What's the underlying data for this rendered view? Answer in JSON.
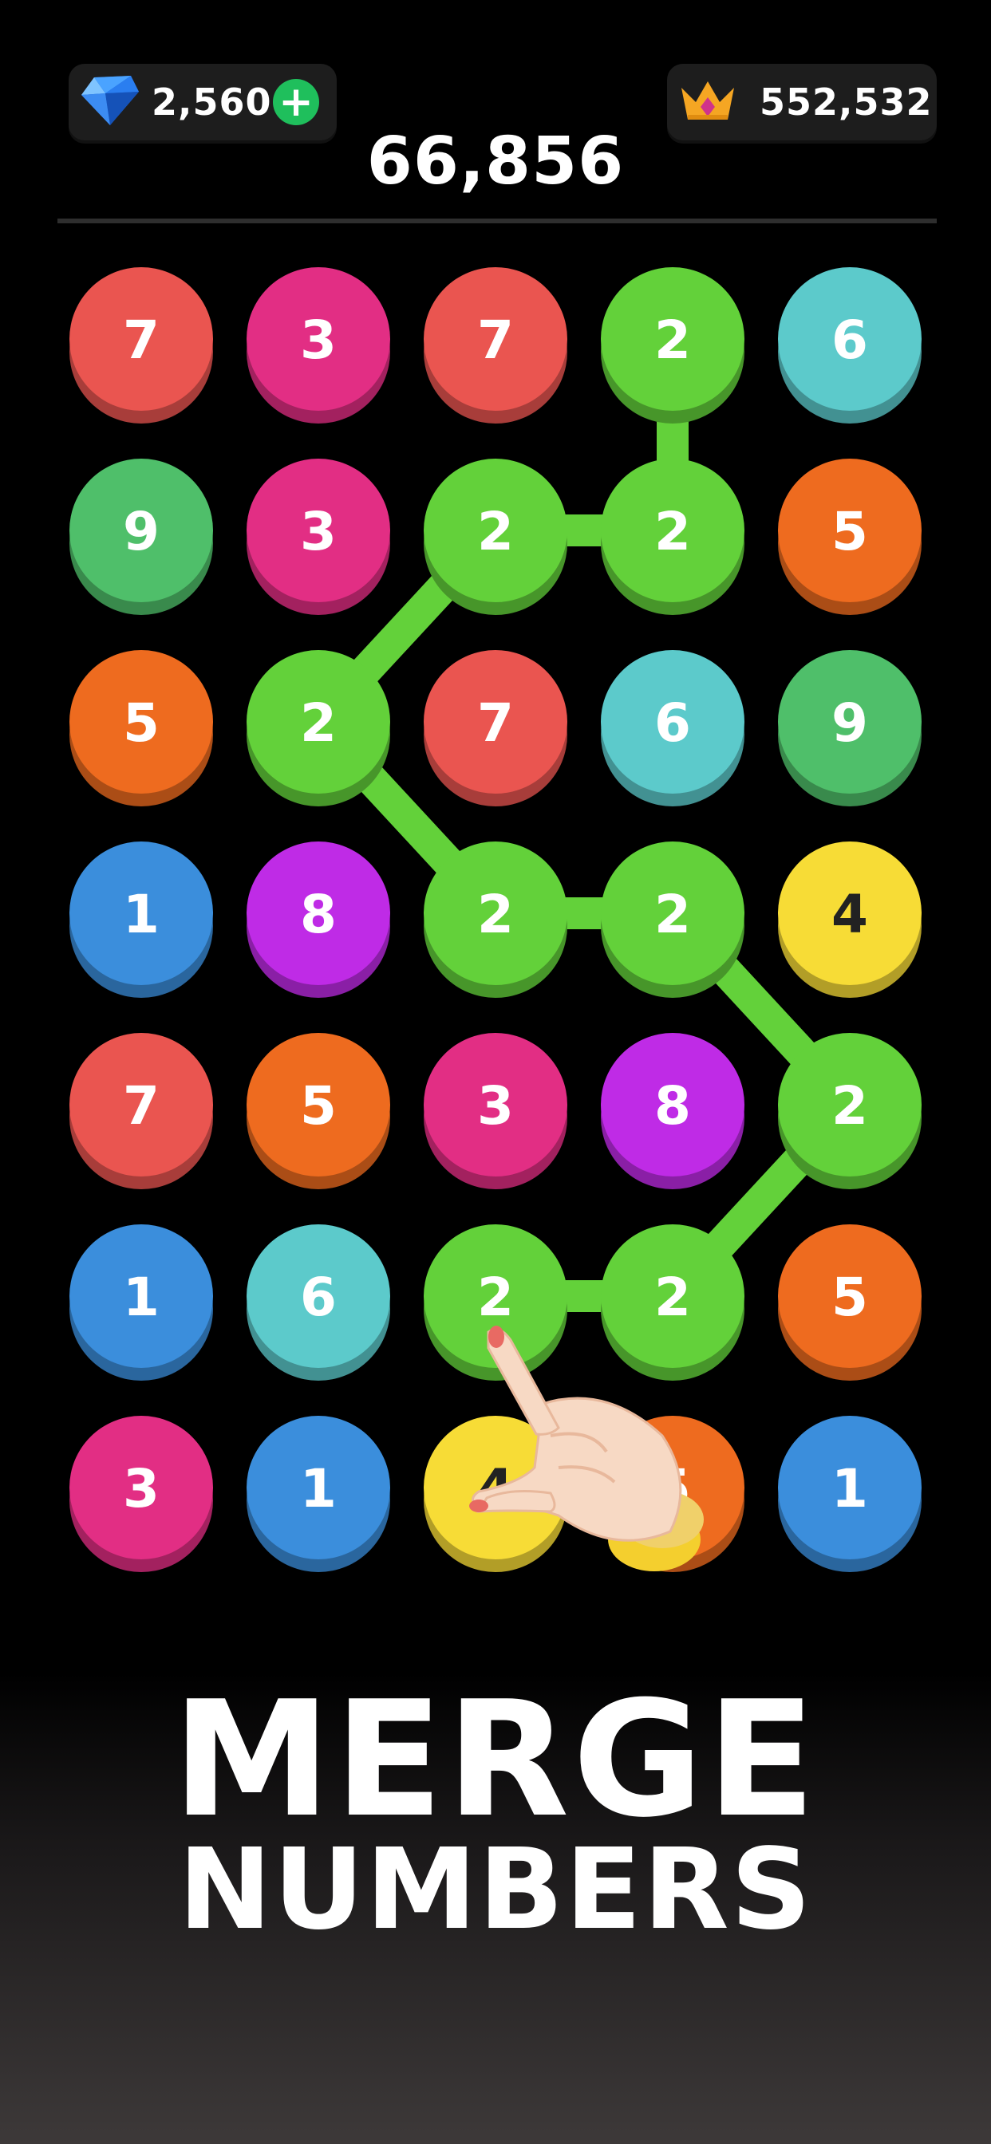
{
  "hud": {
    "gems": "2,560",
    "best_score": "552,532",
    "current_score": "66,856",
    "gem_icon": "blue-diamond-icon",
    "crown_icon": "crown-icon",
    "add_icon": "plus-icon"
  },
  "colors": {
    "1": "#3b8edc",
    "2": "#63d13a",
    "3": "#e22e84",
    "4": "#f7dc36",
    "5": "#ee6b1f",
    "6": "#5ccacb",
    "7": "#ea5550",
    "8": "#bf2be6",
    "9": "#4fbf6a",
    "path": "#63d13a",
    "dark_text": "#222222"
  },
  "board": {
    "rows": [
      [
        "7",
        "3",
        "7",
        "2",
        "6"
      ],
      [
        "9",
        "3",
        "2",
        "2",
        "5"
      ],
      [
        "5",
        "2",
        "7",
        "6",
        "9"
      ],
      [
        "1",
        "8",
        "2",
        "2",
        "4"
      ],
      [
        "7",
        "5",
        "3",
        "8",
        "2"
      ],
      [
        "1",
        "6",
        "2",
        "2",
        "5"
      ],
      [
        "3",
        "1",
        "4",
        "5",
        "1"
      ]
    ],
    "selected_path": [
      [
        0,
        3
      ],
      [
        1,
        3
      ],
      [
        1,
        2
      ],
      [
        2,
        1
      ],
      [
        3,
        2
      ],
      [
        3,
        3
      ],
      [
        4,
        4
      ],
      [
        5,
        3
      ],
      [
        5,
        2
      ]
    ],
    "pointer_icon": "pointing-hand-icon"
  },
  "headline": {
    "line1": "MERGE",
    "line2": "NUMBERS"
  }
}
